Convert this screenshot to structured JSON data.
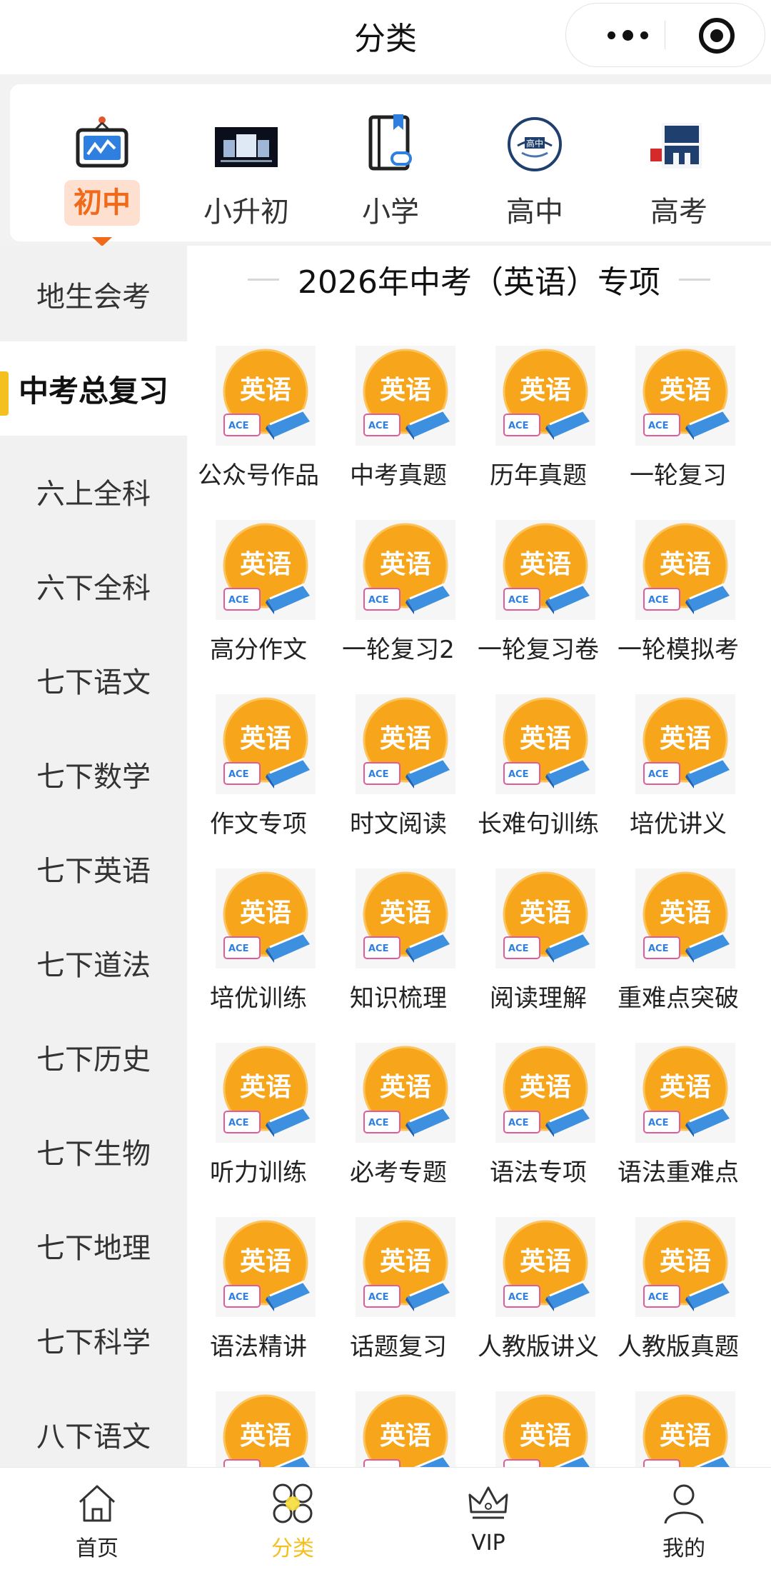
{
  "nav": {
    "title": "分类"
  },
  "grade_tabs": [
    {
      "label": "初中",
      "icon": "chart-board-icon",
      "active": true
    },
    {
      "label": "小升初",
      "icon": "school-photo-icon",
      "active": false
    },
    {
      "label": "小学",
      "icon": "book-bookmark-icon",
      "active": false
    },
    {
      "label": "高中",
      "icon": "graduation-cap-icon",
      "active": false
    },
    {
      "label": "高考",
      "icon": "gaokao-emblem-icon",
      "active": false
    }
  ],
  "sidebar": {
    "items": [
      {
        "label": "地生会考"
      },
      {
        "label": "中考总复习",
        "active": true
      },
      {
        "label": "六上全科"
      },
      {
        "label": "六下全科"
      },
      {
        "label": "七下语文"
      },
      {
        "label": "七下数学"
      },
      {
        "label": "七下英语"
      },
      {
        "label": "七下道法"
      },
      {
        "label": "七下历史"
      },
      {
        "label": "七下生物"
      },
      {
        "label": "七下地理"
      },
      {
        "label": "七下科学"
      },
      {
        "label": "八下语文"
      }
    ]
  },
  "main": {
    "section_title": "2026年中考（英语）专项",
    "badge_text": "英语",
    "items": [
      "公众号作品",
      "中考真题",
      "历年真题",
      "一轮复习",
      "高分作文",
      "一轮复习2",
      "一轮复习卷",
      "一轮模拟考",
      "作文专项",
      "时文阅读",
      "长难句训练",
      "培优讲义",
      "培优训练",
      "知识梳理",
      "阅读理解",
      "重难点突破",
      "听力训练",
      "必考专题",
      "语法专项",
      "语法重难点",
      "语法精讲",
      "话题复习",
      "人教版讲义",
      "人教版真题",
      "",
      "",
      "",
      ""
    ]
  },
  "tabbar": {
    "items": [
      {
        "label": "首页",
        "icon": "home-icon"
      },
      {
        "label": "分类",
        "icon": "category-icon",
        "active": true
      },
      {
        "label": "VIP",
        "icon": "crown-icon"
      },
      {
        "label": "我的",
        "icon": "user-icon"
      }
    ]
  },
  "colors": {
    "accent_orange": "#ef6a1a",
    "accent_yellow": "#f3c020",
    "badge_orange": "#f7a51a"
  }
}
